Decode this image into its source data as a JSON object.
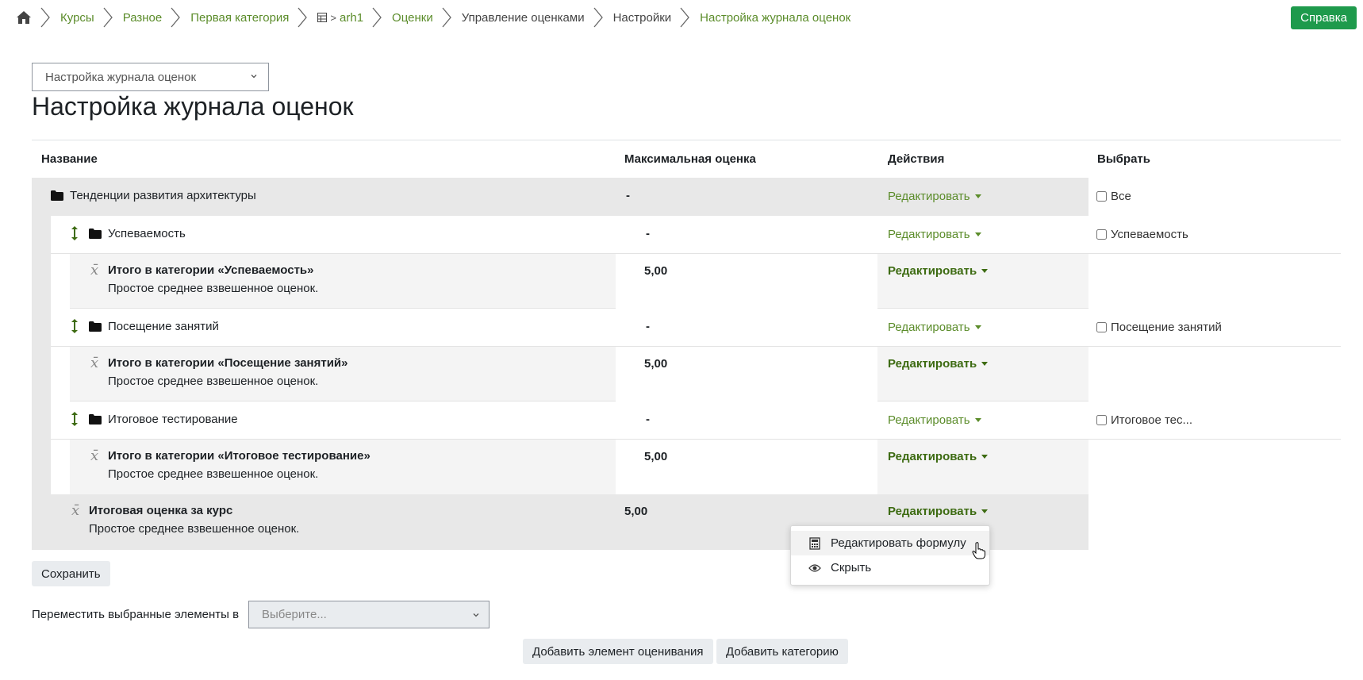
{
  "breadcrumb": {
    "items": [
      "Курсы",
      "Разное",
      "Первая категория",
      "arh1",
      "Оценки",
      "Управление оценками",
      "Настройки",
      "Настройка журнала оценок"
    ]
  },
  "help_label": "Справка",
  "page_select": {
    "value": "Настройка журнала оценок"
  },
  "title": "Настройка журнала оценок",
  "table": {
    "headers": {
      "name": "Название",
      "max": "Максимальная оценка",
      "actions": "Действия",
      "select": "Выбрать"
    },
    "course_category": {
      "name": "Тенденции развития архитектуры",
      "max": "-",
      "action": "Редактировать",
      "checkbox": "Все"
    },
    "categories": [
      {
        "name": "Успеваемость",
        "max": "-",
        "action": "Редактировать",
        "checkbox": "Успеваемость",
        "total_name": "Итого в категории «Успеваемость»",
        "total_desc": "Простое среднее взвешенное оценок.",
        "total_max": "5,00",
        "total_action": "Редактировать"
      },
      {
        "name": "Посещение занятий",
        "max": "-",
        "action": "Редактировать",
        "checkbox": "Посещение занятий",
        "total_name": "Итого в категории «Посещение занятий»",
        "total_desc": "Простое среднее взвешенное оценок.",
        "total_max": "5,00",
        "total_action": "Редактировать"
      },
      {
        "name": "Итоговое тестирование",
        "max": "-",
        "action": "Редактировать",
        "checkbox": "Итоговое тес...",
        "total_name": "Итого в категории «Итоговое тестирование»",
        "total_desc": "Простое среднее взвешенное оценок.",
        "total_max": "5,00",
        "total_action": "Редактировать"
      }
    ],
    "course_total": {
      "name": "Итоговая оценка за курс",
      "desc": "Простое среднее взвешенное оценок.",
      "max": "5,00",
      "action": "Редактировать"
    }
  },
  "dropdown": {
    "items": [
      "Редактировать формулу",
      "Скрыть"
    ]
  },
  "save_label": "Сохранить",
  "move": {
    "label": "Переместить выбранные элементы в",
    "placeholder": "Выберите..."
  },
  "add_item_label": "Добавить элемент оценивания",
  "add_category_label": "Добавить категорию",
  "colors": {
    "accent_green": "#5b8c2a",
    "help_button": "#1e9a4c"
  }
}
